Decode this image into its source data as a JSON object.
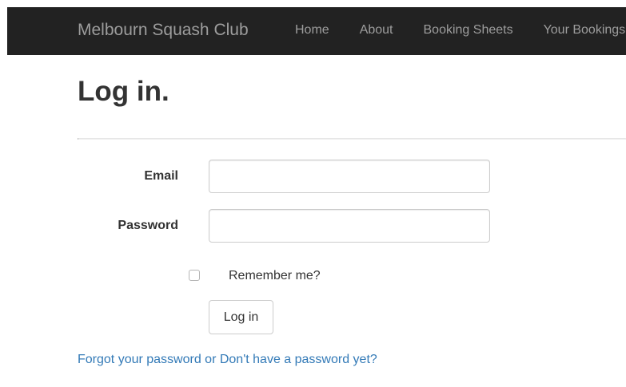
{
  "navbar": {
    "brand": "Melbourn Squash Club",
    "items": [
      {
        "label": "Home"
      },
      {
        "label": "About"
      },
      {
        "label": "Booking Sheets"
      },
      {
        "label": "Your Bookings"
      }
    ]
  },
  "main": {
    "title": "Log in.",
    "email_label": "Email",
    "email_value": "",
    "password_label": "Password",
    "password_value": "",
    "remember_label": "Remember me?",
    "remember_checked": false,
    "login_button": "Log in",
    "help_link": "Forgot your password or Don't have a password yet?"
  },
  "colors": {
    "navbar_bg": "#222222",
    "nav_text": "#9d9d9d",
    "link": "#337ab7"
  }
}
